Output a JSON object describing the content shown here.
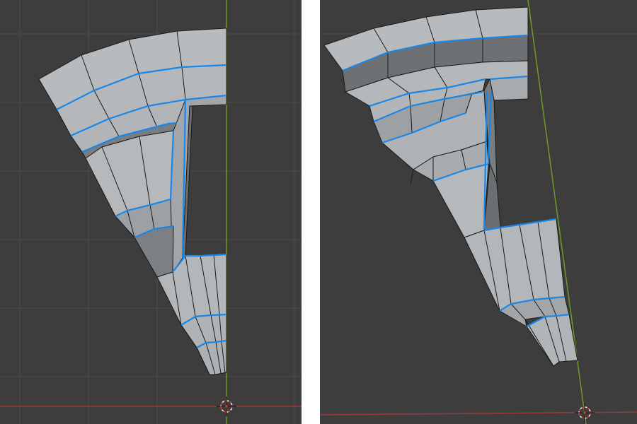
{
  "colors": {
    "viewport_background": "#3d3d3d",
    "grid_line": "#4a4a4a",
    "x_axis": "#9c3a3a",
    "y_axis": "#6f9a27",
    "face_light": "#b8bbbd",
    "face_mid": "#9da0a3",
    "face_dark": "#6e7174",
    "edge": "#1a1a1a",
    "selected_edge": "#1787e8",
    "cursor_red": "#e23b3b",
    "cursor_white": "#f2f2f2",
    "gap_white": "#ffffff"
  },
  "icons": {
    "3d_cursor": "3d-cursor-icon"
  },
  "viewports": [
    {
      "name": "viewport-front"
    },
    {
      "name": "viewport-perspective"
    }
  ]
}
